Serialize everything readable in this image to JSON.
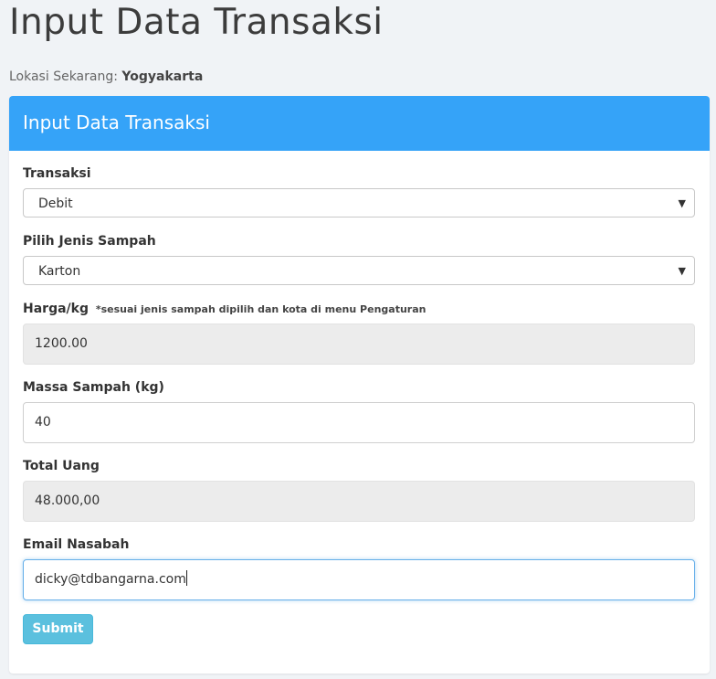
{
  "page": {
    "title": "Input Data Transaksi",
    "location_label": "Lokasi Sekarang:",
    "location_value": "Yogyakarta"
  },
  "panel": {
    "heading": "Input Data Transaksi"
  },
  "form": {
    "transaksi": {
      "label": "Transaksi",
      "value": "Debit"
    },
    "jenis_sampah": {
      "label": "Pilih Jenis Sampah",
      "value": "Karton"
    },
    "harga": {
      "label": "Harga/kg",
      "note": "*sesuai jenis sampah dipilih dan kota di menu Pengaturan",
      "value": "1200.00"
    },
    "massa": {
      "label": "Massa Sampah (kg)",
      "value": "40"
    },
    "total": {
      "label": "Total Uang",
      "value": "48.000,00"
    },
    "email": {
      "label": "Email Nasabah",
      "value": "dicky@tdbangarna.com"
    },
    "submit_label": "Submit"
  },
  "icons": {
    "dropdown": "caret-down-icon"
  }
}
